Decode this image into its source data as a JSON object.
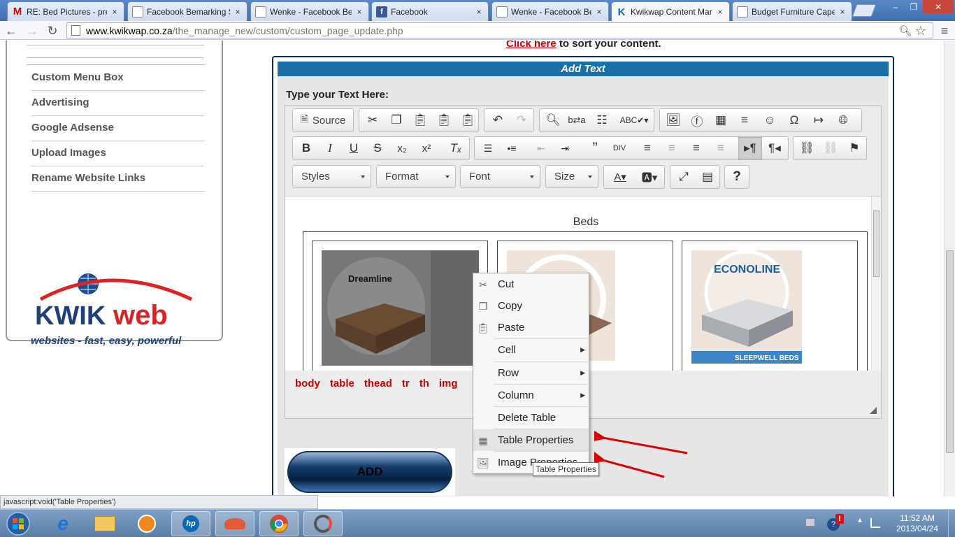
{
  "browser": {
    "tabs": [
      {
        "title": "RE: Bed Pictures - pret",
        "icon": "gmail-icon"
      },
      {
        "title": "Facebook Bemarking S",
        "icon": "page-icon"
      },
      {
        "title": "Wenke - Facebook Ber",
        "icon": "page-icon"
      },
      {
        "title": "Facebook",
        "icon": "facebook-icon"
      },
      {
        "title": "Wenke - Facebook Ber",
        "icon": "page-icon"
      },
      {
        "title": "Kwikwap Content Mar",
        "icon": "kwikwap-icon"
      },
      {
        "title": "Budget Furniture Cape",
        "icon": "page-icon"
      }
    ],
    "close_glyph": "×",
    "url_host": "www.kwikwap.co.za",
    "url_path": "/the_manage_new/custom/custom_page_update.php",
    "status_text": "javascript:void('Table Properties')"
  },
  "sidebar": {
    "items": [
      "Custom Menu Box",
      "Advertising",
      "Google Adsense",
      "Upload Images",
      "Rename Website Links"
    ],
    "logo_word1": "KWIK",
    "logo_word2": "web",
    "logo_tagline": "websites - fast, easy, powerful"
  },
  "page": {
    "click_here": "Click here",
    "click_rest": " to sort your content.",
    "panel_title": "Add Text",
    "type_label": "Type your Text Here:",
    "add_button": "ADD"
  },
  "editor": {
    "toolbar": {
      "source": "Source",
      "styles": "Styles",
      "format": "Format",
      "font": "Font",
      "size": "Size"
    },
    "content_title": "Beds",
    "image1_label": "Dreamline",
    "image3_label": "ECONOLINE",
    "image3_banner": "SLEEPWELL BEDS",
    "path": [
      "body",
      "table",
      "thead",
      "tr",
      "th",
      "img"
    ]
  },
  "context_menu": {
    "items": [
      {
        "label": "Cut",
        "icon": "scissors-icon",
        "submenu": false
      },
      {
        "label": "Copy",
        "icon": "copy-icon",
        "submenu": false
      },
      {
        "label": "Paste",
        "icon": "paste-icon",
        "submenu": false
      },
      {
        "label": "Cell",
        "icon": "",
        "submenu": true
      },
      {
        "label": "Row",
        "icon": "",
        "submenu": true
      },
      {
        "label": "Column",
        "icon": "",
        "submenu": true
      },
      {
        "label": "Delete Table",
        "icon": "",
        "submenu": false
      },
      {
        "label": "Table Properties",
        "icon": "table-icon",
        "submenu": false
      },
      {
        "label": "Image Properties",
        "icon": "image-icon",
        "submenu": false
      }
    ],
    "tooltip": "Table Properties"
  },
  "taskbar": {
    "time": "11:52 AM",
    "date": "2013/04/24"
  },
  "colors": {
    "accent_blue": "#1a6fa6",
    "path_red": "#cc0000",
    "arrow_red": "#e00000"
  }
}
